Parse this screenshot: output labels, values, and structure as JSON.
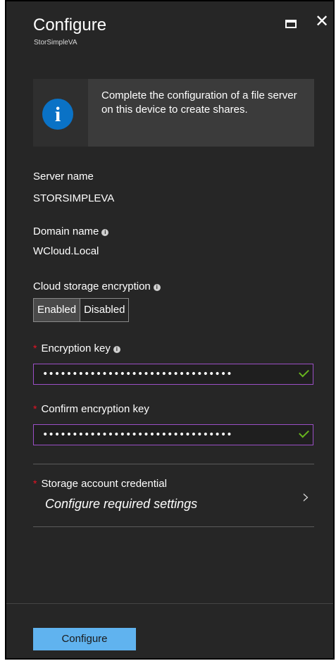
{
  "header": {
    "title": "Configure",
    "subtitle": "StorSimpleVA",
    "close_glyph": "✕"
  },
  "info": {
    "icon_glyph": "i",
    "message": "Complete the configuration of a file server on this device to create shares."
  },
  "server": {
    "label": "Server name",
    "value": "STORSIMPLEVA"
  },
  "domain": {
    "label": "Domain name",
    "value": "WCloud.Local"
  },
  "encryption": {
    "label": "Cloud storage encryption",
    "options": [
      "Enabled",
      "Disabled"
    ],
    "selected": "Enabled"
  },
  "encryption_key": {
    "label": "Encryption key",
    "value": "••••••••••••••••••••••••••••••••"
  },
  "confirm_key": {
    "label": "Confirm encryption key",
    "value": "••••••••••••••••••••••••••••••••"
  },
  "credential": {
    "label": "Storage account credential",
    "value": "Configure required settings",
    "chevron": "›"
  },
  "footer": {
    "configure_label": "Configure"
  },
  "colors": {
    "background": "#262626",
    "accent_button": "#60b3ef",
    "info_icon": "#0a72c6",
    "field_border": "#9b4fc6",
    "valid_check": "#68b51e",
    "required_star": "#e81123"
  }
}
